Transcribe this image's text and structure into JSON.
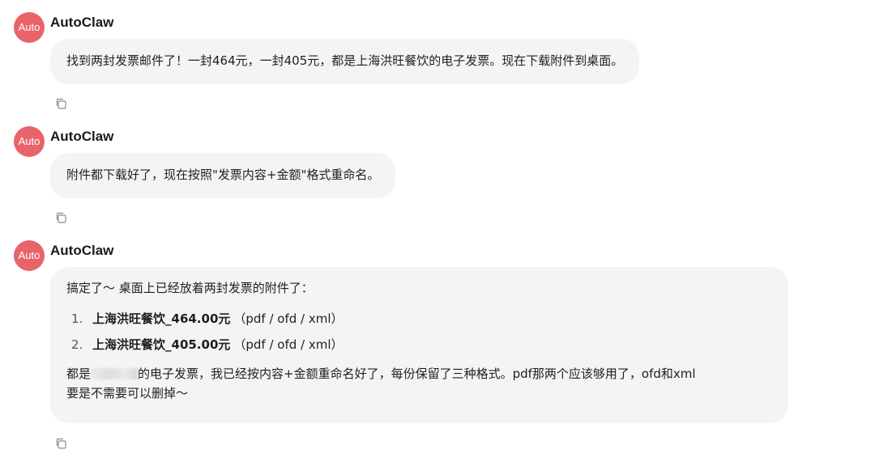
{
  "messages": [
    {
      "avatar": "Auto",
      "sender": "AutoClaw",
      "text": "找到两封发票邮件了！一封464元，一封405元，都是上海洪旺餐饮的电子发票。现在下载附件到桌面。"
    },
    {
      "avatar": "Auto",
      "sender": "AutoClaw",
      "text": "附件都下载好了，现在按照\"发票内容+金额\"格式重命名。"
    },
    {
      "avatar": "Auto",
      "sender": "AutoClaw",
      "intro": "搞定了～ 桌面上已经放着两封发票的附件了：",
      "list": [
        {
          "num": "1.",
          "name": "上海洪旺餐饮_464.00元",
          "formats": "（pdf / ofd / xml）"
        },
        {
          "num": "2.",
          "name": "上海洪旺餐饮_405.00元",
          "formats": "（pdf / ofd / xml）"
        }
      ],
      "outro_start": "都是",
      "outro_mid": "的电子发票，我已经按内容+金额重命名好了，每份保留了三种格式。pdf那两个应该够用了，ofd和xml",
      "outro_end": "要是不需要可以删掉～"
    }
  ],
  "icons": {
    "copy": "copy-icon"
  },
  "colors": {
    "avatar_bg": "#e8646a",
    "bubble_bg": "#f4f4f5"
  }
}
